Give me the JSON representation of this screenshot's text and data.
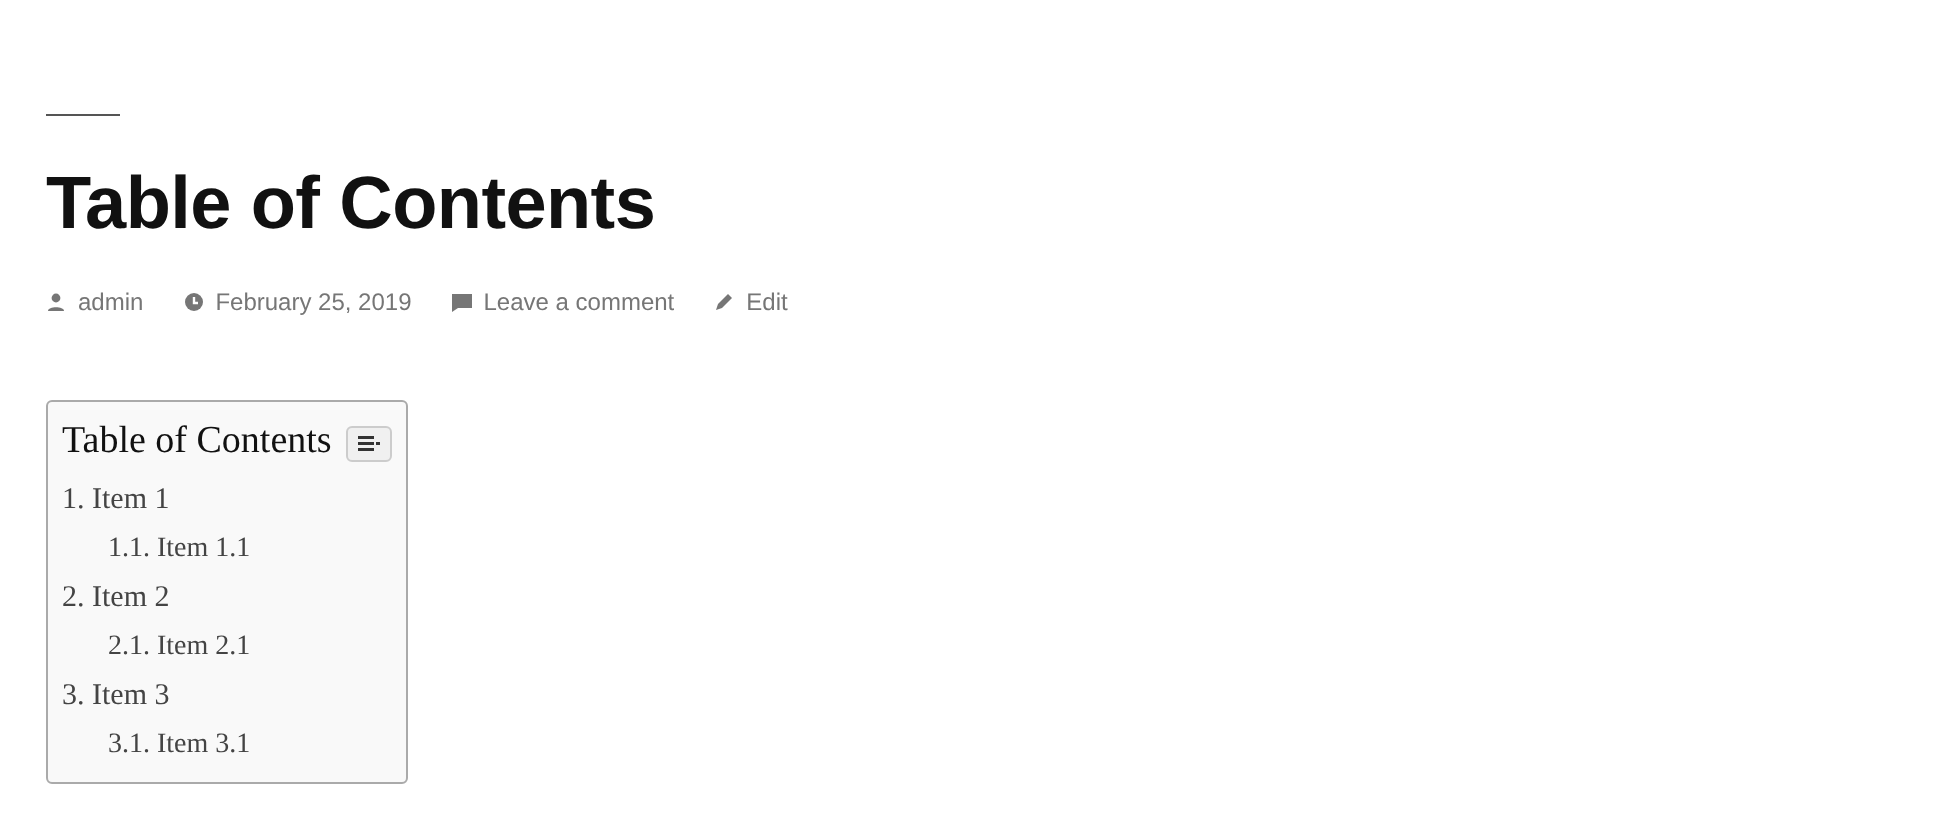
{
  "title": "Table of Contents",
  "meta": [
    {
      "kind": "author",
      "text": "admin"
    },
    {
      "kind": "date",
      "text": "February 25, 2019"
    },
    {
      "kind": "comment",
      "text": "Leave a comment"
    },
    {
      "kind": "edit",
      "text": "Edit"
    }
  ],
  "toc": {
    "title": "Table of Contents",
    "items": [
      {
        "label": "1. Item 1",
        "children": [
          {
            "label": "1.1. Item 1.1"
          }
        ]
      },
      {
        "label": "2. Item 2",
        "children": [
          {
            "label": "2.1. Item 2.1"
          }
        ]
      },
      {
        "label": "3. Item 3",
        "children": [
          {
            "label": "3.1. Item 3.1"
          }
        ]
      }
    ]
  }
}
